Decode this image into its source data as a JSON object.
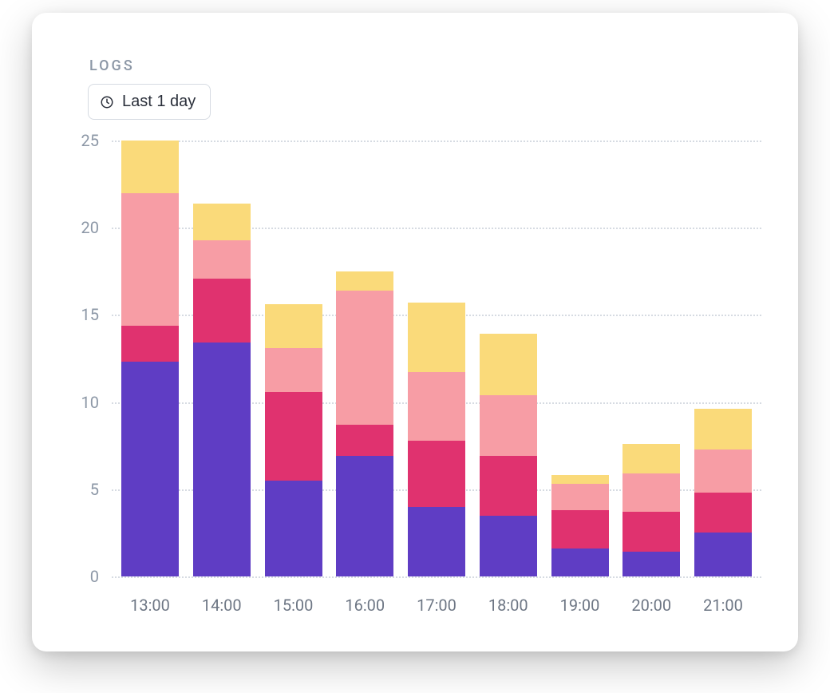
{
  "header": {
    "section_label": "LOGS",
    "range_label": "Last 1 day"
  },
  "chart_data": {
    "type": "bar",
    "stacked": true,
    "title": "",
    "xlabel": "",
    "ylabel": "",
    "ylim": [
      0,
      25
    ],
    "yticks": [
      0,
      5,
      10,
      15,
      20,
      25
    ],
    "categories": [
      "13:00",
      "14:00",
      "15:00",
      "16:00",
      "17:00",
      "18:00",
      "19:00",
      "20:00",
      "21:00"
    ],
    "series": [
      {
        "name": "purple",
        "color": "#5f3dc4",
        "values": [
          12.3,
          13.4,
          5.5,
          6.9,
          4.0,
          3.5,
          1.6,
          1.4,
          2.5
        ]
      },
      {
        "name": "magenta",
        "color": "#e0326f",
        "values": [
          2.1,
          3.7,
          5.1,
          1.8,
          3.8,
          3.4,
          2.2,
          2.3,
          2.3
        ]
      },
      {
        "name": "pink",
        "color": "#f79da5",
        "values": [
          7.6,
          2.2,
          2.5,
          7.7,
          3.9,
          3.5,
          1.5,
          2.2,
          2.5
        ]
      },
      {
        "name": "yellow",
        "color": "#fada7a",
        "values": [
          3.0,
          2.1,
          2.5,
          1.1,
          4.0,
          3.5,
          0.5,
          1.7,
          2.3
        ]
      }
    ]
  }
}
